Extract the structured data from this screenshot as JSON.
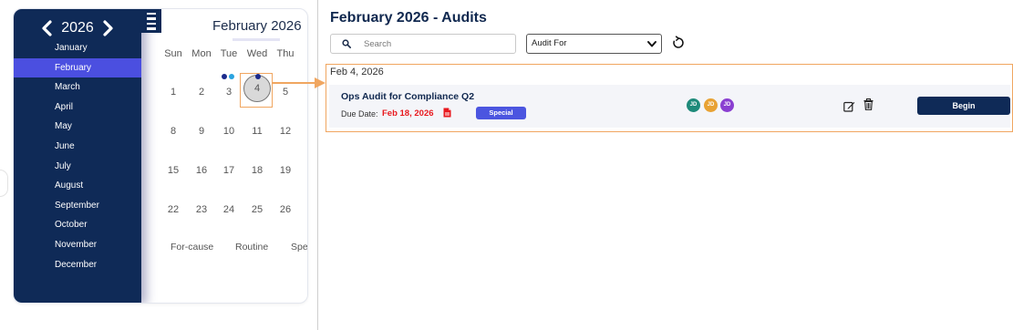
{
  "calendar": {
    "year": "2026",
    "prev_year_icon": "chevron-left-icon",
    "next_year_icon": "chevron-right-icon",
    "menu_icon": "hamburger-menu-icon",
    "months": [
      "January",
      "February",
      "March",
      "April",
      "May",
      "June",
      "July",
      "August",
      "September",
      "October",
      "November",
      "December"
    ],
    "active_month": "February",
    "title": "February 2026",
    "weekdays": [
      "Sun",
      "Mon",
      "Tue",
      "Wed",
      "Thu"
    ],
    "weeks": [
      [
        "1",
        "2",
        "3",
        "4",
        "5"
      ],
      [
        "8",
        "9",
        "10",
        "11",
        "12"
      ],
      [
        "15",
        "16",
        "17",
        "18",
        "19"
      ],
      [
        "22",
        "23",
        "24",
        "25",
        "26"
      ]
    ],
    "selected_day": "4",
    "legend": [
      "For-cause",
      "Routine",
      "Spe"
    ],
    "dot_colors": {
      "for_cause": "#1b2a8c",
      "routine": "#2aa3e0"
    }
  },
  "main": {
    "title": "February 2026 - Audits",
    "search": {
      "placeholder": "Search",
      "icon": "search-icon"
    },
    "filter": {
      "selected": "Audit For",
      "icon": "chevron-down-icon"
    },
    "refresh_icon": "refresh-icon",
    "sections": [
      {
        "date_label": "Feb 4, 2026",
        "audits": [
          {
            "title": "Ops Audit for Compliance Q2",
            "due_label": "Due Date:",
            "due_date": "Feb 18, 2026",
            "due_icon": "pdf-icon",
            "badge": "Special",
            "assignees": [
              {
                "initials": "JD",
                "color": "#1e8a7a"
              },
              {
                "initials": "JD",
                "color": "#e8a234"
              },
              {
                "initials": "JD",
                "color": "#8a3fd1"
              }
            ],
            "edit_icon": "edit-icon",
            "delete_icon": "trash-icon",
            "action_label": "Begin"
          }
        ]
      }
    ]
  },
  "colors": {
    "navy": "#0f2a57",
    "accent": "#4b4fe0",
    "highlight": "#f0a660",
    "due_red": "#e8191e",
    "badge": "#4b55e0"
  }
}
